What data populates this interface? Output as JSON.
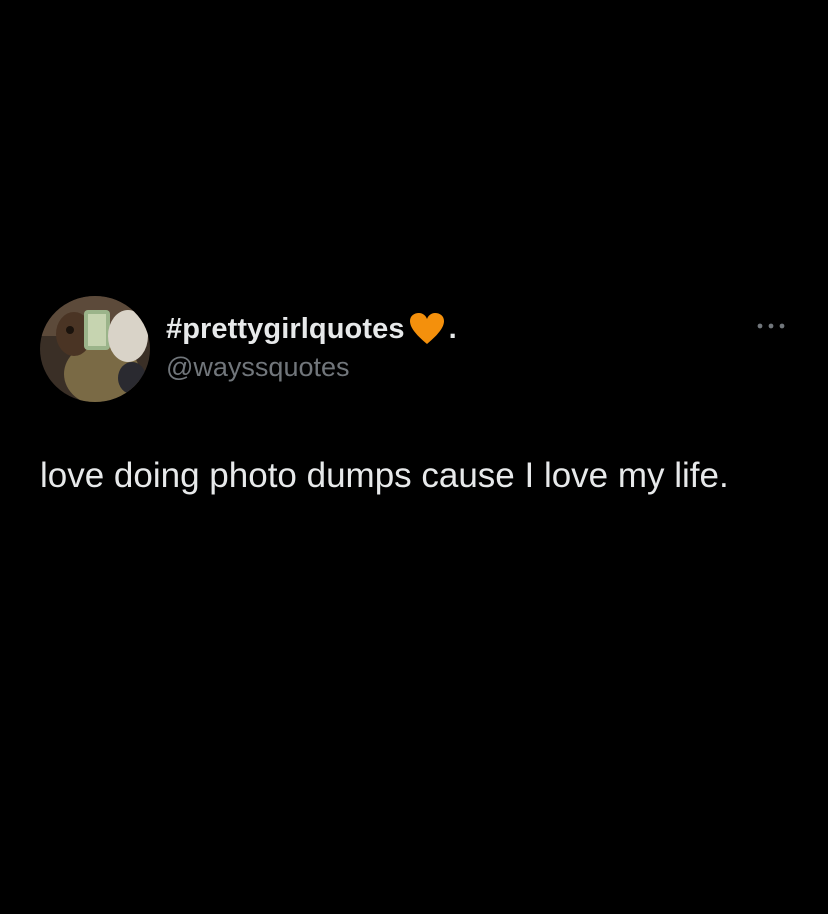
{
  "tweet": {
    "display_name": "#prettygirlquotes",
    "emoji_icon": "orange-heart-icon",
    "display_name_suffix": ".",
    "handle": "@wayssquotes",
    "text": "love doing photo dumps cause I love my life.",
    "more_icon": "ellipsis-icon"
  },
  "colors": {
    "background": "#000000",
    "primary_text": "#e7e9ea",
    "secondary_text": "#71767b",
    "heart": "#f4900c"
  }
}
